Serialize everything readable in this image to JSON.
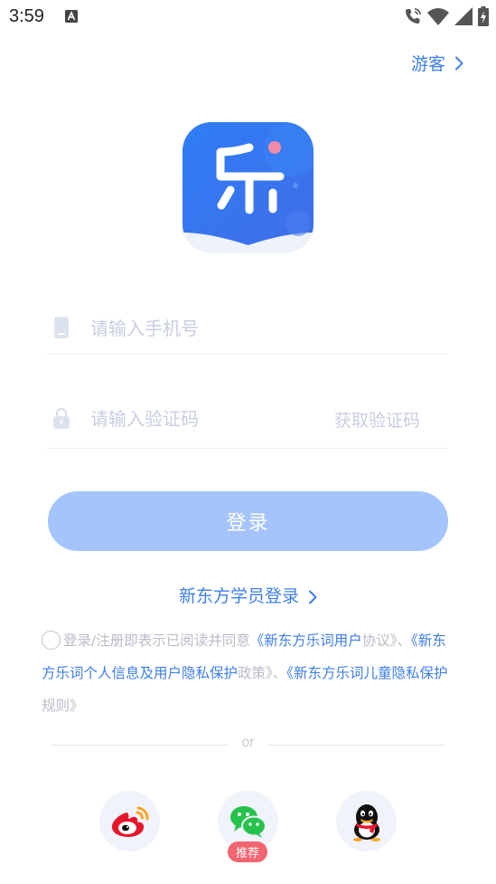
{
  "status_bar": {
    "time": "3:59",
    "notification_icon": "a-notification-icon",
    "icons": [
      "wifi-call-icon",
      "wifi-icon",
      "signal-icon",
      "battery-charging-icon"
    ]
  },
  "header": {
    "guest_label": "游客"
  },
  "logo": {
    "icon": "app-logo-icon",
    "colors": {
      "primary": "#3479f0",
      "dot": "#f48aa6"
    }
  },
  "form": {
    "phone_placeholder": "请输入手机号",
    "code_placeholder": "请输入验证码",
    "get_code_label": "获取验证码",
    "login_label": "登录"
  },
  "student_login_label": "新东方学员登录",
  "agreement": {
    "prefix": "登录/注册即表示已阅读并同意",
    "link1": "《新东方乐词用户",
    "mid1": "协议》、",
    "link2": "《新东方乐词个人信息及用户隐私保护",
    "mid2": "政策》、",
    "link3": "《新东方乐词儿童隐私保护",
    "suffix": "规则》"
  },
  "divider_label": "or",
  "social": {
    "items": [
      "weibo-icon",
      "wechat-icon",
      "qq-icon"
    ],
    "recommend_badge": "推荐"
  },
  "colors": {
    "accent": "#3e7ee8",
    "button_disabled": "#a5c4fb",
    "placeholder": "#c7cedf",
    "badge": "#f2646f"
  }
}
